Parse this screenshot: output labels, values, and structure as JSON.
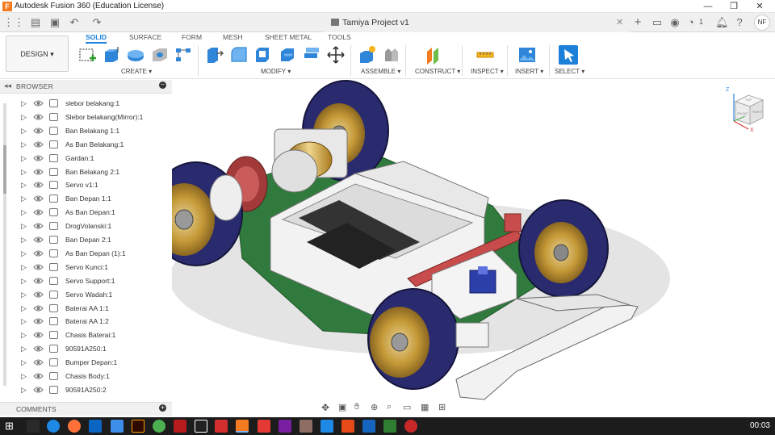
{
  "window": {
    "title": "Autodesk Fusion 360 (Education License)",
    "app_icon": "F",
    "controls": [
      "—",
      "❐",
      "✕"
    ]
  },
  "appbar": {
    "document_tab": "Tamiya Project v1",
    "job_count": "1",
    "user_initials": "NF"
  },
  "toolbar": {
    "workspace": "DESIGN ▾",
    "tabs": [
      "SOLID",
      "SURFACE",
      "FORM",
      "MESH",
      "SHEET METAL",
      "TOOLS"
    ],
    "groups": [
      "CREATE ▾",
      "MODIFY ▾",
      "ASSEMBLE ▾",
      "CONSTRUCT ▾",
      "INSPECT ▾",
      "INSERT ▾",
      "SELECT ▾"
    ]
  },
  "browser": {
    "header": "BROWSER",
    "items": [
      "slebor belakang:1",
      "Slebor belakang(Mirror):1",
      "Ban Belakang 1:1",
      "As Ban Belakang:1",
      "Gardan:1",
      "Ban Belakang 2:1",
      "Servo v1:1",
      "Ban Depan 1:1",
      "As Ban Depan:1",
      "DrogVolanski:1",
      "Ban Depan 2:1",
      "As Ban Depan (1):1",
      "Servo Kunci:1",
      "Servo Support:1",
      "Servo Wadah:1",
      "Baterai AA 1:1",
      "Baterai AA 1:2",
      "Chasis Baterai:1",
      "90591A250:1",
      "Bumper Depan:1",
      "Chasis Body:1",
      "90591A250:2"
    ]
  },
  "comments": {
    "label": "COMMENTS"
  },
  "viewcube": {
    "faces": [
      "TOP",
      "FRONT",
      "RIGHT"
    ],
    "axes": [
      "Z",
      "X",
      "Y"
    ]
  },
  "taskbar": {
    "clock": "00:03"
  },
  "colors": {
    "accent": "#1c80d8",
    "brand": "#f47b20",
    "taskbar": "#1c1c1c"
  }
}
